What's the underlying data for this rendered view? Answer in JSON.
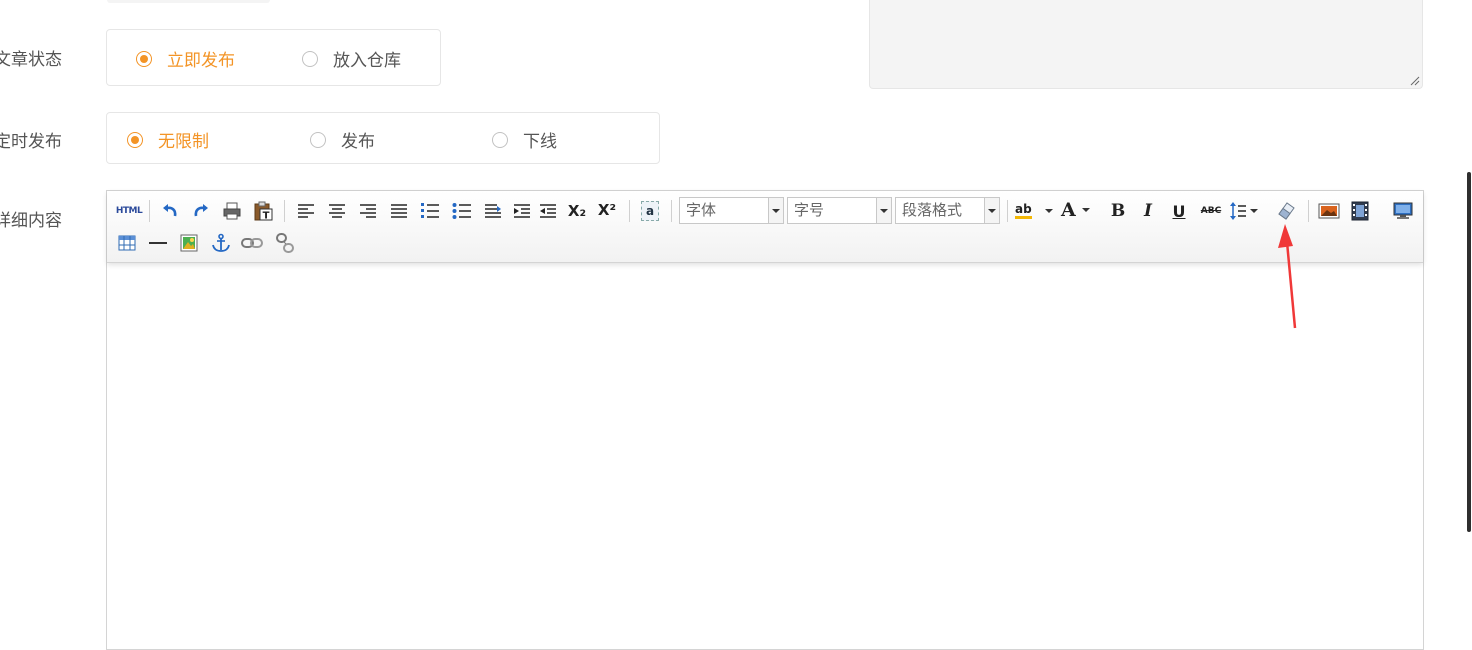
{
  "form": {
    "status_label": "文章状态",
    "status_options": [
      "立即发布",
      "放入仓库"
    ],
    "schedule_label": "定时发布",
    "schedule_options": [
      "无限制",
      "发布",
      "下线"
    ],
    "content_label": "详细内容"
  },
  "editor": {
    "html_label": "HTML",
    "font_family_placeholder": "字体",
    "font_size_placeholder": "字号",
    "paragraph_placeholder": "段落格式",
    "text_color_letter": "A",
    "bold_letter": "B",
    "italic_letter": "I",
    "underline_letter": "U",
    "strikethrough_label": "ABC",
    "subscript_letter": "X₂",
    "superscript_letter": "X²",
    "highlight_letters": "ab",
    "at_letter": "a"
  },
  "colors": {
    "accent": "#f39426",
    "annotation_arrow": "#f03838"
  }
}
